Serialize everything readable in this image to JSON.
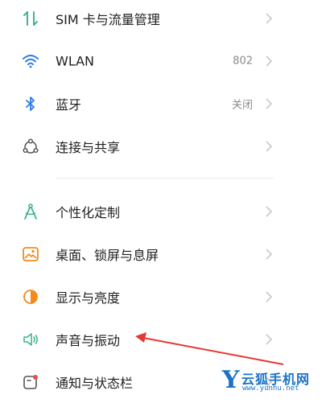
{
  "settings": {
    "group1": [
      {
        "label": "SIM 卡与流量管理",
        "value": "",
        "icon": "sim-data-icon"
      },
      {
        "label": "WLAN",
        "value": "802",
        "icon": "wifi-icon"
      },
      {
        "label": "蓝牙",
        "value": "关闭",
        "icon": "bluetooth-icon"
      },
      {
        "label": "连接与共享",
        "value": "",
        "icon": "connection-share-icon"
      }
    ],
    "group2": [
      {
        "label": "个性化定制",
        "value": "",
        "icon": "personalize-icon"
      },
      {
        "label": "桌面、锁屏与息屏",
        "value": "",
        "icon": "wallpaper-icon"
      },
      {
        "label": "显示与亮度",
        "value": "",
        "icon": "display-brightness-icon"
      },
      {
        "label": "声音与振动",
        "value": "",
        "icon": "sound-icon"
      },
      {
        "label": "通知与状态栏",
        "value": "",
        "icon": "notification-icon"
      }
    ]
  },
  "colors": {
    "arrow": "#e53935",
    "icon_green": "#3fb58c",
    "icon_blue": "#2b7be3",
    "icon_orange": "#f28a1c",
    "icon_red": "#e8504b",
    "watermark": "#1a73c7"
  },
  "watermark": {
    "logo_letter": "Y",
    "name": "云狐手机网",
    "url": "www.yunhu.net"
  }
}
